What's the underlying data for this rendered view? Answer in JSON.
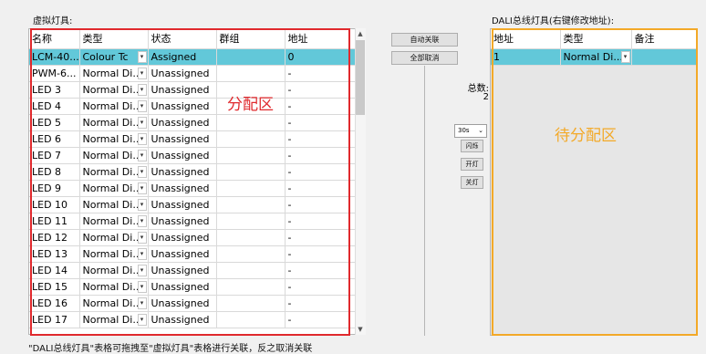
{
  "left_panel": {
    "title": "虚拟灯具:",
    "columns": [
      "名称",
      "类型",
      "状态",
      "群组",
      "地址"
    ],
    "rows": [
      {
        "name": "LCM-40...",
        "type": "Colour Tc",
        "status": "Assigned",
        "group": "",
        "address": "0",
        "selected": true
      },
      {
        "name": "PWM-6...",
        "type": "Normal Di...",
        "status": "Unassigned",
        "group": "",
        "address": "-",
        "selected": false
      },
      {
        "name": "LED 3",
        "type": "Normal Di...",
        "status": "Unassigned",
        "group": "",
        "address": "-",
        "selected": false
      },
      {
        "name": "LED 4",
        "type": "Normal Di...",
        "status": "Unassigned",
        "group": "",
        "address": "-",
        "selected": false
      },
      {
        "name": "LED 5",
        "type": "Normal Di...",
        "status": "Unassigned",
        "group": "",
        "address": "-",
        "selected": false
      },
      {
        "name": "LED 6",
        "type": "Normal Di...",
        "status": "Unassigned",
        "group": "",
        "address": "-",
        "selected": false
      },
      {
        "name": "LED 7",
        "type": "Normal Di...",
        "status": "Unassigned",
        "group": "",
        "address": "-",
        "selected": false
      },
      {
        "name": "LED 8",
        "type": "Normal Di...",
        "status": "Unassigned",
        "group": "",
        "address": "-",
        "selected": false
      },
      {
        "name": "LED 9",
        "type": "Normal Di...",
        "status": "Unassigned",
        "group": "",
        "address": "-",
        "selected": false
      },
      {
        "name": "LED 10",
        "type": "Normal Di...",
        "status": "Unassigned",
        "group": "",
        "address": "-",
        "selected": false
      },
      {
        "name": "LED 11",
        "type": "Normal Di...",
        "status": "Unassigned",
        "group": "",
        "address": "-",
        "selected": false
      },
      {
        "name": "LED 12",
        "type": "Normal Di...",
        "status": "Unassigned",
        "group": "",
        "address": "-",
        "selected": false
      },
      {
        "name": "LED 13",
        "type": "Normal Di...",
        "status": "Unassigned",
        "group": "",
        "address": "-",
        "selected": false
      },
      {
        "name": "LED 14",
        "type": "Normal Di...",
        "status": "Unassigned",
        "group": "",
        "address": "-",
        "selected": false
      },
      {
        "name": "LED 15",
        "type": "Normal Di...",
        "status": "Unassigned",
        "group": "",
        "address": "-",
        "selected": false
      },
      {
        "name": "LED 16",
        "type": "Normal Di...",
        "status": "Unassigned",
        "group": "",
        "address": "-",
        "selected": false
      },
      {
        "name": "LED 17",
        "type": "Normal Di...",
        "status": "Unassigned",
        "group": "",
        "address": "-",
        "selected": false
      }
    ],
    "zone_label": "分配区",
    "zone_color": "#e0292d",
    "selected_color": "#62c8d9"
  },
  "middle": {
    "auto_link_button": "自动关联",
    "unlink_all_button": "全部取消",
    "total_label": "总数:",
    "total_count": "2",
    "time_select_value": "30s",
    "flash_button": "闪烁",
    "on_button": "开灯",
    "off_button": "关灯"
  },
  "right_panel": {
    "title": "DALI总线灯具(右键修改地址):",
    "columns": [
      "地址",
      "类型",
      "备注"
    ],
    "rows": [
      {
        "address": "1",
        "type": "Normal Di...",
        "note": "",
        "selected": true
      }
    ],
    "zone_label": "待分配区",
    "zone_color": "#f3a928"
  },
  "footer_note": "\"DALI总线灯具\"表格可拖拽至\"虚拟灯具\"表格进行关联，反之取消关联"
}
